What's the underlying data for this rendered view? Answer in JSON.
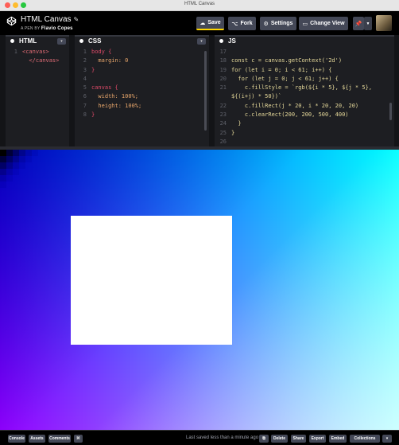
{
  "window": {
    "title": "HTML Canvas"
  },
  "header": {
    "pen_title": "HTML Canvas",
    "by_prefix": "A PEN BY",
    "author": "Flavio Copes",
    "buttons": {
      "save": "Save",
      "fork": "Fork",
      "settings": "Settings",
      "change_view": "Change View"
    }
  },
  "editors": {
    "html": {
      "title": "HTML",
      "lines": [
        {
          "n": "1",
          "text": "<canvas>"
        },
        {
          "n": "",
          "text": "  </canvas>"
        }
      ]
    },
    "css": {
      "title": "CSS",
      "lines": [
        {
          "n": "1",
          "text": "body {"
        },
        {
          "n": "2",
          "text": "  margin: 0"
        },
        {
          "n": "3",
          "text": "}"
        },
        {
          "n": "4",
          "text": ""
        },
        {
          "n": "5",
          "text": "canvas {"
        },
        {
          "n": "6",
          "text": "  width: 100%;"
        },
        {
          "n": "7",
          "text": "  height: 100%;"
        },
        {
          "n": "8",
          "text": "}"
        }
      ]
    },
    "js": {
      "title": "JS",
      "lines": [
        {
          "n": "17",
          "text": ""
        },
        {
          "n": "18",
          "text": "const c = canvas.getContext('2d')"
        },
        {
          "n": "19",
          "text": "for (let i = 0; i < 61; i++) {"
        },
        {
          "n": "20",
          "text": "  for (let j = 0; j < 61; j++) {"
        },
        {
          "n": "21",
          "text": "    c.fillStyle = `rgb(${i * 5}, ${j * 5},"
        },
        {
          "n": "",
          "text": "${(i+j) * 50})`"
        },
        {
          "n": "22",
          "text": "    c.fillRect(j * 20, i * 20, 20, 20)"
        },
        {
          "n": "23",
          "text": "    c.clearRect(200, 200, 500, 400)"
        },
        {
          "n": "24",
          "text": "  }"
        },
        {
          "n": "25",
          "text": "}"
        },
        {
          "n": "26",
          "text": ""
        }
      ]
    }
  },
  "footer": {
    "left_buttons": [
      "Console",
      "Assets",
      "Comments",
      "⌘"
    ],
    "status": "Last saved less than a minute ago",
    "right_buttons": [
      "Delete",
      "Share",
      "Export",
      "Embed",
      "Collections"
    ]
  },
  "colors": {
    "accent": "#ffd600",
    "button_bg": "#444857",
    "header_bg": "#000000",
    "editor_bg": "#1d1e22"
  },
  "icons": {
    "logo": "codepen-logo-icon",
    "pencil": "pencil-icon",
    "save": "cloud-icon",
    "fork": "fork-icon",
    "settings": "gear-icon",
    "view": "layout-icon",
    "pin": "pin-icon"
  }
}
